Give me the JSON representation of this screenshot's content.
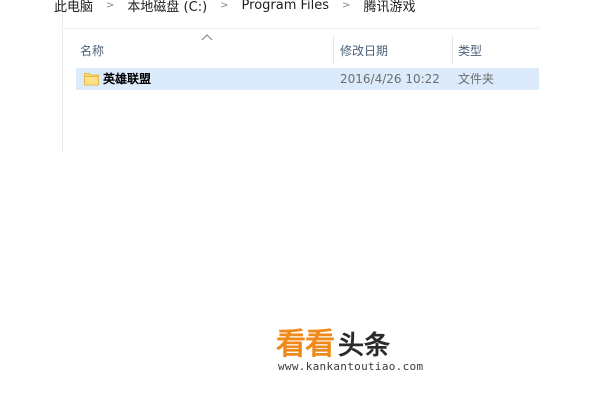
{
  "breadcrumb": {
    "items": [
      "此电脑",
      "本地磁盘 (C:)",
      "Program Files",
      "腾讯游戏"
    ],
    "separator": ">"
  },
  "columns": {
    "name": "名称",
    "date_modified": "修改日期",
    "type": "类型",
    "sort_icon": "chevron-up-icon"
  },
  "files": [
    {
      "name": "英雄联盟",
      "date_modified": "2016/4/26 10:22",
      "type": "文件夹",
      "icon": "folder-icon",
      "selected": true
    }
  ],
  "watermark": {
    "brand_orange": "看看",
    "brand_dark": "头条",
    "url": "www.kankantoutiao.com"
  },
  "colors": {
    "selection": "#dcebfb",
    "header_text": "#4c607a",
    "folder": "#ffd866",
    "watermark_orange": "#ef8a1a"
  }
}
